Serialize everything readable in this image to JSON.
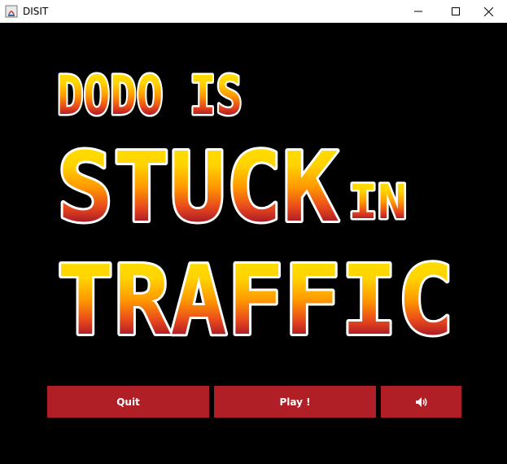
{
  "window": {
    "title": "DISIT",
    "controls": {
      "minimize": "minimize-icon",
      "maximize": "maximize-icon",
      "close": "close-icon"
    }
  },
  "logo": {
    "line1": "DODO IS",
    "line2": "STUCK",
    "line2b": "IN",
    "line3": "TRAFFIC",
    "colors": {
      "top": "#ffe600",
      "mid": "#ff9800",
      "low": "#e8481c",
      "bottom": "#b01e26",
      "outline": "#ffffff"
    }
  },
  "menu": {
    "quit_label": "Quit",
    "play_label": "Play !",
    "sound_icon": "speaker-icon",
    "button_color": "#b01e26"
  }
}
